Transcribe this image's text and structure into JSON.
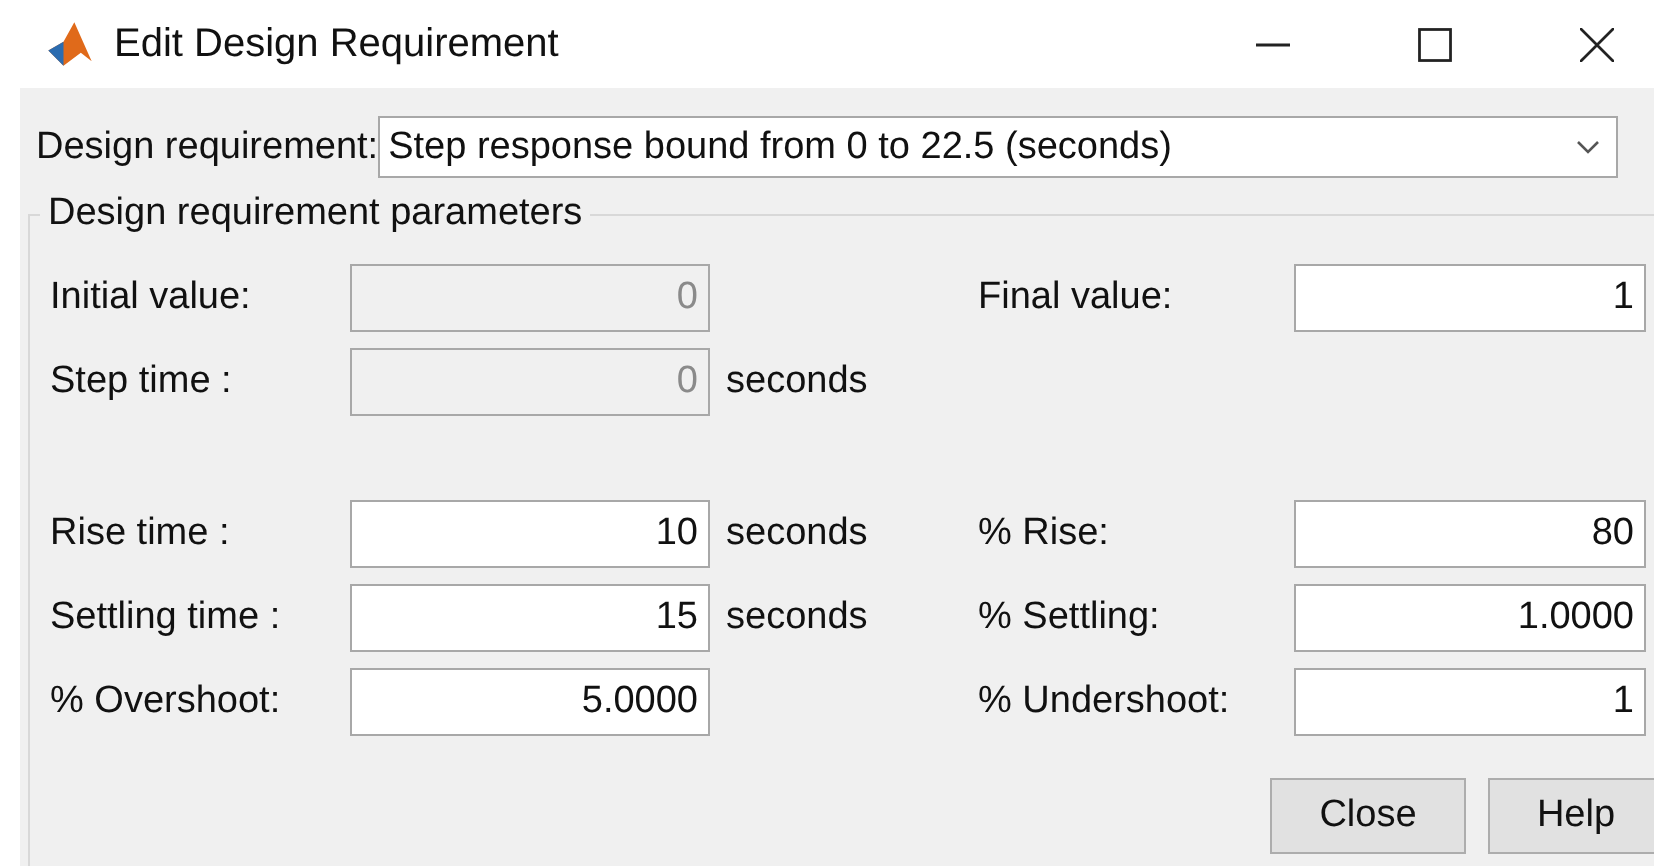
{
  "window": {
    "title": "Edit Design Requirement"
  },
  "design_requirement": {
    "label": "Design requirement:",
    "value": "Step response bound from 0 to 22.5 (seconds)"
  },
  "group": {
    "title": "Design requirement parameters",
    "sections": [
      [
        {
          "left": {
            "label": "Initial value:",
            "value": "0",
            "disabled": true
          },
          "right": {
            "label": "Final value:",
            "value": "1",
            "disabled": false
          }
        },
        {
          "left": {
            "label": "Step time :",
            "value": "0",
            "disabled": true,
            "unit": "seconds"
          }
        }
      ],
      [
        {
          "left": {
            "label": "Rise time :",
            "value": "10",
            "disabled": false,
            "unit": "seconds"
          },
          "right": {
            "label": "% Rise:",
            "value": "80",
            "disabled": false
          }
        },
        {
          "left": {
            "label": "Settling time :",
            "value": "15",
            "disabled": false,
            "unit": "seconds"
          },
          "right": {
            "label": "% Settling:",
            "value": "1.0000",
            "disabled": false
          }
        },
        {
          "left": {
            "label": "% Overshoot:",
            "value": "5.0000",
            "disabled": false
          },
          "right": {
            "label": "% Undershoot:",
            "value": "1",
            "disabled": false
          }
        }
      ]
    ]
  },
  "buttons": [
    "Close",
    "Help"
  ]
}
